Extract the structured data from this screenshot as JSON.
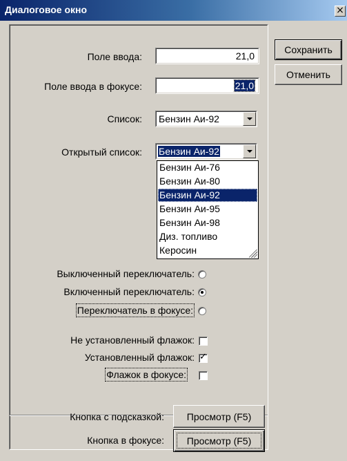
{
  "window": {
    "title": "Диалоговое окно",
    "close_glyph": "×"
  },
  "side_buttons": {
    "save": "Сохранить",
    "cancel": "Отменить"
  },
  "fields": {
    "input": {
      "label": "Поле ввода:",
      "value": "21,0"
    },
    "input_focused": {
      "label": "Поле ввода в фокусе:",
      "value": "21,0"
    },
    "combo": {
      "label": "Список:",
      "value": "Бензин Аи-92"
    },
    "combo_open": {
      "label": "Открытый список:",
      "value": "Бензин Аи-92"
    }
  },
  "dropdown_list": {
    "items": [
      "Бензин Аи-76",
      "Бензин Аи-80",
      "Бензин Аи-92",
      "Бензин Аи-95",
      "Бензин Аи-98",
      "Диз. топливо",
      "Керосин"
    ],
    "selected_index": 2
  },
  "radios": [
    {
      "label": "Выключенный переключатель:",
      "checked": false,
      "focused": false
    },
    {
      "label": "Включенный переключатель:",
      "checked": true,
      "focused": false
    },
    {
      "label": "Переключатель в фокусе:",
      "checked": false,
      "focused": true
    }
  ],
  "checkboxes": [
    {
      "label": "Не установленный флажок:",
      "checked": false,
      "focused": false
    },
    {
      "label": "Установленный флажок:",
      "checked": true,
      "focused": false
    },
    {
      "label": "Флажок в фокусе:",
      "checked": false,
      "focused": true
    }
  ],
  "buttons_bottom": {
    "hint_label": "Кнопка с подсказкой:",
    "hint_button": "Просмотр (F5)",
    "focus_label": "Кнопка в фокусе:",
    "focus_button": "Просмотр (F5)"
  },
  "colors": {
    "face": "#d4d0c8",
    "title_start": "#0a246a",
    "title_end": "#a6caf0",
    "selection": "#0a246a"
  }
}
